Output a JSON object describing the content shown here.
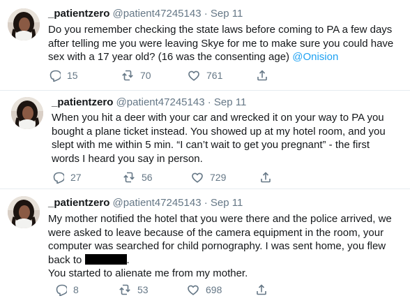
{
  "tweets": [
    {
      "name": "_patientzero",
      "handle": "@patient47245143",
      "sep": "·",
      "date": "Sep 11",
      "lines": [
        "Do you remember checking the state laws before coming to PA a few days",
        "after telling me you were leaving Skye for me to make sure you could have",
        "sex with a 17 year old? (16 was the consenting age) "
      ],
      "mention": "@Onision",
      "replies": "15",
      "retweets": "70",
      "likes": "761"
    },
    {
      "name": "_patientzero",
      "handle": "@patient47245143",
      "sep": "·",
      "date": "Sep 11",
      "lines": [
        "When you hit a deer with your car and wrecked it on your way to PA you",
        "bought a plane ticket instead. You showed up at my hotel room, and you",
        "slept with me within 5 min. “I can’t wait to get you pregnant” - the first",
        "words I heard you say in person."
      ],
      "replies": "27",
      "retweets": "56",
      "likes": "729"
    },
    {
      "name": "_patientzero",
      "handle": "@patient47245143",
      "sep": "·",
      "date": "Sep 11",
      "lines": [
        "My mother notified the hotel that you were there and the police arrived, we",
        "were asked to leave because of the camera equipment in the room, your",
        "computer was searched for child pornography. I was sent home, you flew",
        "back to ",
        "You started to alienate me from my mother."
      ],
      "line4_end": ".",
      "replies": "8",
      "retweets": "53",
      "likes": "698"
    }
  ],
  "icons": [
    "reply-icon",
    "retweet-icon",
    "like-icon",
    "share-icon"
  ],
  "colors": {
    "text": "#14171a",
    "muted": "#657786",
    "link": "#1da1f2",
    "divider": "#e6ecf0"
  }
}
